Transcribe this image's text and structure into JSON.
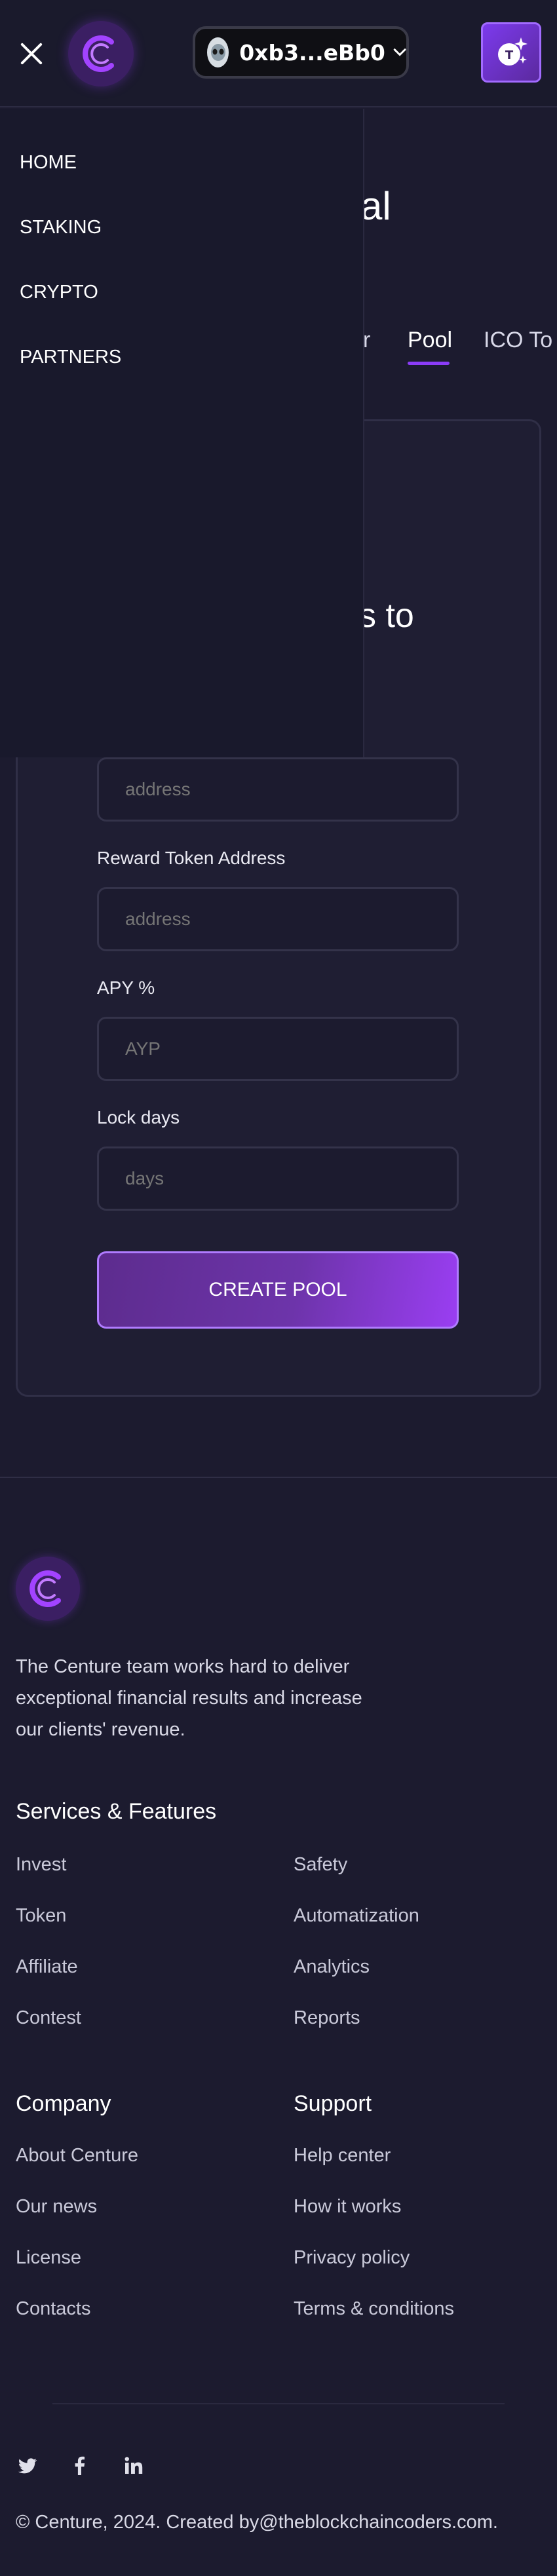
{
  "header": {
    "wallet_address": "0xb3...eBb0",
    "close_icon": "close-icon",
    "logo_letter": "C"
  },
  "drawer": {
    "items": [
      {
        "label": "HOME"
      },
      {
        "label": "STAKING"
      },
      {
        "label": "CRYPTO"
      },
      {
        "label": "PARTNERS"
      }
    ]
  },
  "page": {
    "heading_fragment": "al",
    "card_text_fragment": "s to",
    "tabs": [
      {
        "label": "r"
      },
      {
        "label": "Pool",
        "active": true
      },
      {
        "label": "ICO To"
      }
    ]
  },
  "form": {
    "fields": [
      {
        "label": "",
        "placeholder": "address"
      },
      {
        "label": "Reward Token Address",
        "placeholder": "address"
      },
      {
        "label": "APY %",
        "placeholder": "AYP"
      },
      {
        "label": "Lock days",
        "placeholder": "days"
      }
    ],
    "submit_label": "CREATE POOL"
  },
  "footer": {
    "description": "The Centure team works hard to deliver exceptional financial results and increase our clients' revenue.",
    "services_heading": "Services & Features",
    "services_left": [
      "Invest",
      "Token",
      "Affiliate",
      "Contest"
    ],
    "services_right": [
      "Safety",
      "Automatization",
      "Analytics",
      "Reports"
    ],
    "company_heading": "Company",
    "company_links": [
      "About Centure",
      "Our news",
      "License",
      "Contacts"
    ],
    "support_heading": "Support",
    "support_links": [
      "Help center",
      "How it works",
      "Privacy policy",
      "Terms & conditions"
    ],
    "social": [
      "twitter-icon",
      "facebook-icon",
      "linkedin-icon"
    ],
    "copyright": "© Centure, 2024. Created by@theblockchaincoders.com."
  },
  "colors": {
    "background": "#1c1b2f",
    "accent": "#8b3cf7",
    "button_gradient_end": "#9a3ef2"
  }
}
